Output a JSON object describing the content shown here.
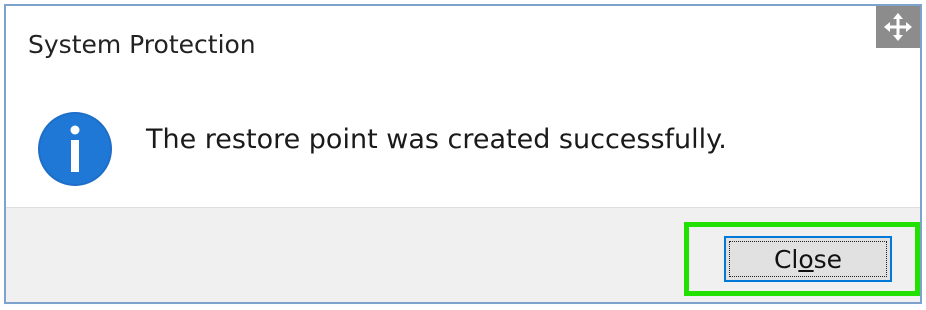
{
  "dialog": {
    "title": "System Protection",
    "message": "The restore point was created successfully.",
    "icon": "info-icon",
    "move_handle_icon": "move-icon",
    "accent_color": "#0078d7",
    "highlight_color": "#22e000"
  },
  "footer": {
    "close_button": {
      "label_before": "Cl",
      "label_mnemonic": "o",
      "label_after": "se"
    }
  }
}
